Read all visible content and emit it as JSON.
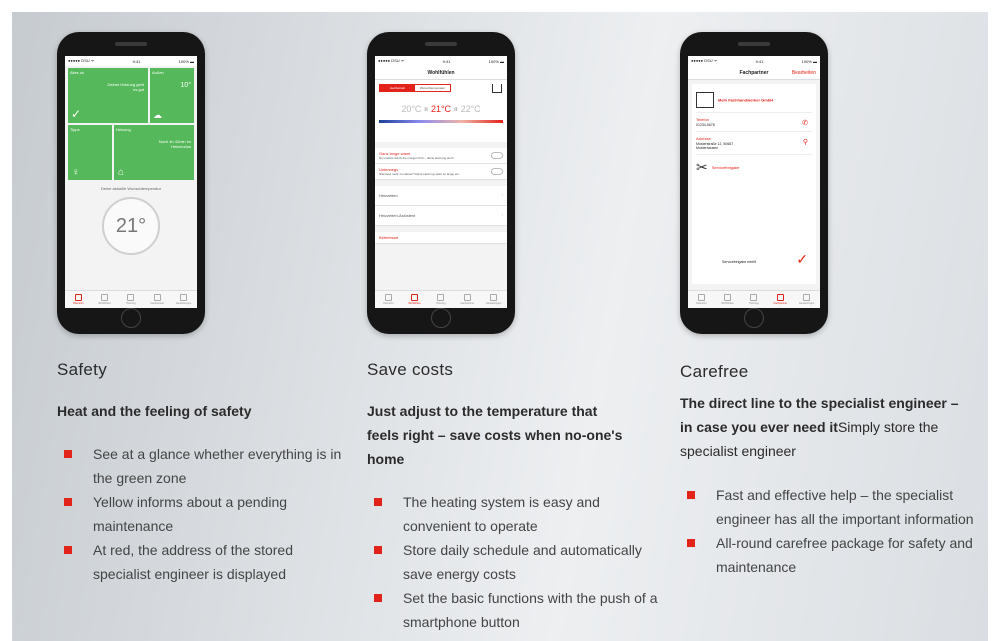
{
  "columns": [
    {
      "heading": "Safety",
      "lead": "Heat and the feeling of safety",
      "lead_after": "",
      "bullets": [
        "See at a glance whether everything is in the green zone",
        "Yellow informs about a pending maintenance",
        "At red, the address of the stored specialist engineer is displayed"
      ]
    },
    {
      "heading": "Save costs",
      "lead": "Just adjust to the temperature that feels right – save costs when no-one's home",
      "lead_after": "",
      "bullets": [
        "The heating system is easy and convenient to operate",
        "Store daily schedule and automatically save energy costs",
        "Set the basic functions with the push of a smartphone button"
      ]
    },
    {
      "heading": "Carefree",
      "lead": "The direct line to the specialist engineer – in case you ever need it",
      "lead_after": "Simply store the specialist engineer",
      "bullets": [
        "Fast and effective help – the specialist engineer has all the important information",
        "All-round carefree package for safety and maintenance"
      ]
    }
  ],
  "phone1": {
    "status_left": "●●●●● DSU ᯤ",
    "status_time": "9:41",
    "status_right": "100% ▬",
    "tile1_title": "Alles ok",
    "tile1_text": "Deiner Heizung geht es gut",
    "tile2_title": "Außen",
    "tile2_value": "10°",
    "tile3_title": "Tipps",
    "tile4_title": "Heizung",
    "tile4_text": "Noch 4h 42min im Heizmodus",
    "wish_label": "Deine aktuelle Wunschtemperatur",
    "dial_value": "21°"
  },
  "phone2": {
    "status_left": "●●●●● DSU ᯤ",
    "status_time": "9:41",
    "status_right": "100% ▬",
    "title": "Wohlfühlen",
    "seg_on": "Heizbetrieb",
    "seg_off": "Wunschtemperatur",
    "temp_low": "20°C",
    "temp_mid": "21°C",
    "temp_high": "22°C",
    "row1_title": "Ganz lange warm",
    "row1_text": "Du machst durch die morgen früh – deine Heizung auch.",
    "row2_title": "Unterwegs",
    "row2_text": "Niemand mehr zu Hause? Deine Heizung spart so lange ein.",
    "row3": "Heizzeiten",
    "row4": "Heizzeiten-Assistent",
    "row5": "Betriebsart"
  },
  "phone3": {
    "status_left": "●●●●● DSU ᯤ",
    "status_time": "9:41",
    "status_right": "100% ▬",
    "title": "Fachpartner",
    "edit": "Bearbeiten",
    "company": "Mein Fachhandwerker GmbH",
    "phone_caption": "Telefon",
    "phone_value": "01234-5678",
    "address_caption": "Adresse",
    "address_value": "Musterstraße 12, 50667 Musterhausen",
    "service_caption": "Servicefreigabe",
    "service_value": "Servicefreigabe erteilt"
  },
  "tabs": [
    "Übersicht",
    "Wohlfühlen",
    "Heizung",
    "Fachpartner",
    "Einstellungen"
  ]
}
